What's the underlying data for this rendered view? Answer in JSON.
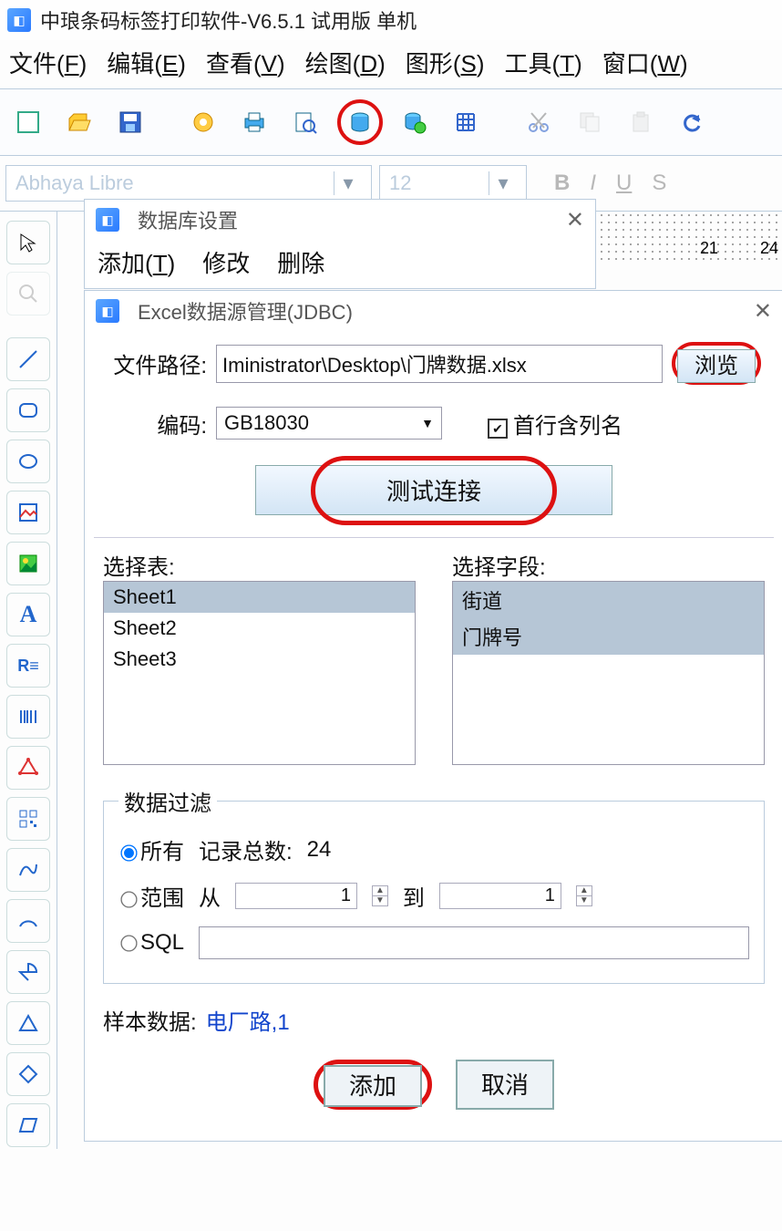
{
  "app": {
    "title": "中琅条码标签打印软件-V6.5.1 试用版 单机"
  },
  "menu": {
    "file": "文件",
    "file_u": "F",
    "edit": "编辑",
    "edit_u": "E",
    "view": "查看",
    "view_u": "V",
    "draw": "绘图",
    "draw_u": "D",
    "shape": "图形",
    "shape_u": "S",
    "tool": "工具",
    "tool_u": "T",
    "window": "窗口",
    "window_u": "W"
  },
  "font_bar": {
    "font_name": "Abhaya Libre",
    "font_size": "12",
    "bold": "B",
    "italic": "I",
    "underline": "U",
    "strike": "S"
  },
  "ruler": {
    "m1": "21",
    "m2": "24"
  },
  "dialog1": {
    "title": "数据库设置",
    "add": "添加",
    "add_u": "T",
    "modify": "修改",
    "delete": "删除"
  },
  "dialog2": {
    "title": "Excel数据源管理(JDBC)",
    "file_path_lbl": "文件路径:",
    "file_path_val": "Iministrator\\Desktop\\门牌数据.xlsx",
    "browse": "浏览",
    "encoding_lbl": "编码:",
    "encoding_val": "GB18030",
    "first_row_header": "首行含列名",
    "test_conn": "测试连接",
    "select_table_lbl": "选择表:",
    "tables": [
      "Sheet1",
      "Sheet2",
      "Sheet3"
    ],
    "select_field_lbl": "选择字段:",
    "fields": [
      "街道",
      "门牌号"
    ],
    "filter_legend": "数据过滤",
    "radio_all": "所有",
    "record_count_lbl": "记录总数:",
    "record_count_val": "24",
    "radio_range": "范围",
    "from_lbl": "从",
    "from_val": "1",
    "to_lbl": "到",
    "to_val": "1",
    "radio_sql": "SQL",
    "sql_val": "",
    "sample_lbl": "样本数据:",
    "sample_val": "电厂路,1",
    "btn_add": "添加",
    "btn_cancel": "取消"
  }
}
